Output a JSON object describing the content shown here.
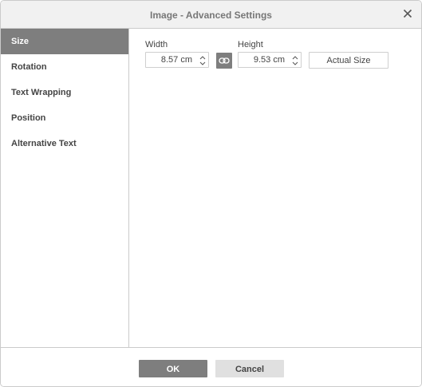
{
  "dialog": {
    "title": "Image - Advanced Settings",
    "close_icon": "close-icon"
  },
  "sidebar": {
    "items": [
      {
        "label": "Size",
        "active": true
      },
      {
        "label": "Rotation",
        "active": false
      },
      {
        "label": "Text Wrapping",
        "active": false
      },
      {
        "label": "Position",
        "active": false
      },
      {
        "label": "Alternative Text",
        "active": false
      }
    ]
  },
  "size": {
    "width_label": "Width",
    "width_value": "8.57 cm",
    "height_label": "Height",
    "height_value": "9.53 cm",
    "constrain_icon": "link-icon",
    "actual_size_label": "Actual Size"
  },
  "footer": {
    "ok_label": "OK",
    "cancel_label": "Cancel"
  },
  "colors": {
    "active_bg": "#7e7e7e",
    "titlebar_bg": "#f1f1f1",
    "cancel_bg": "#e0e0e0"
  }
}
